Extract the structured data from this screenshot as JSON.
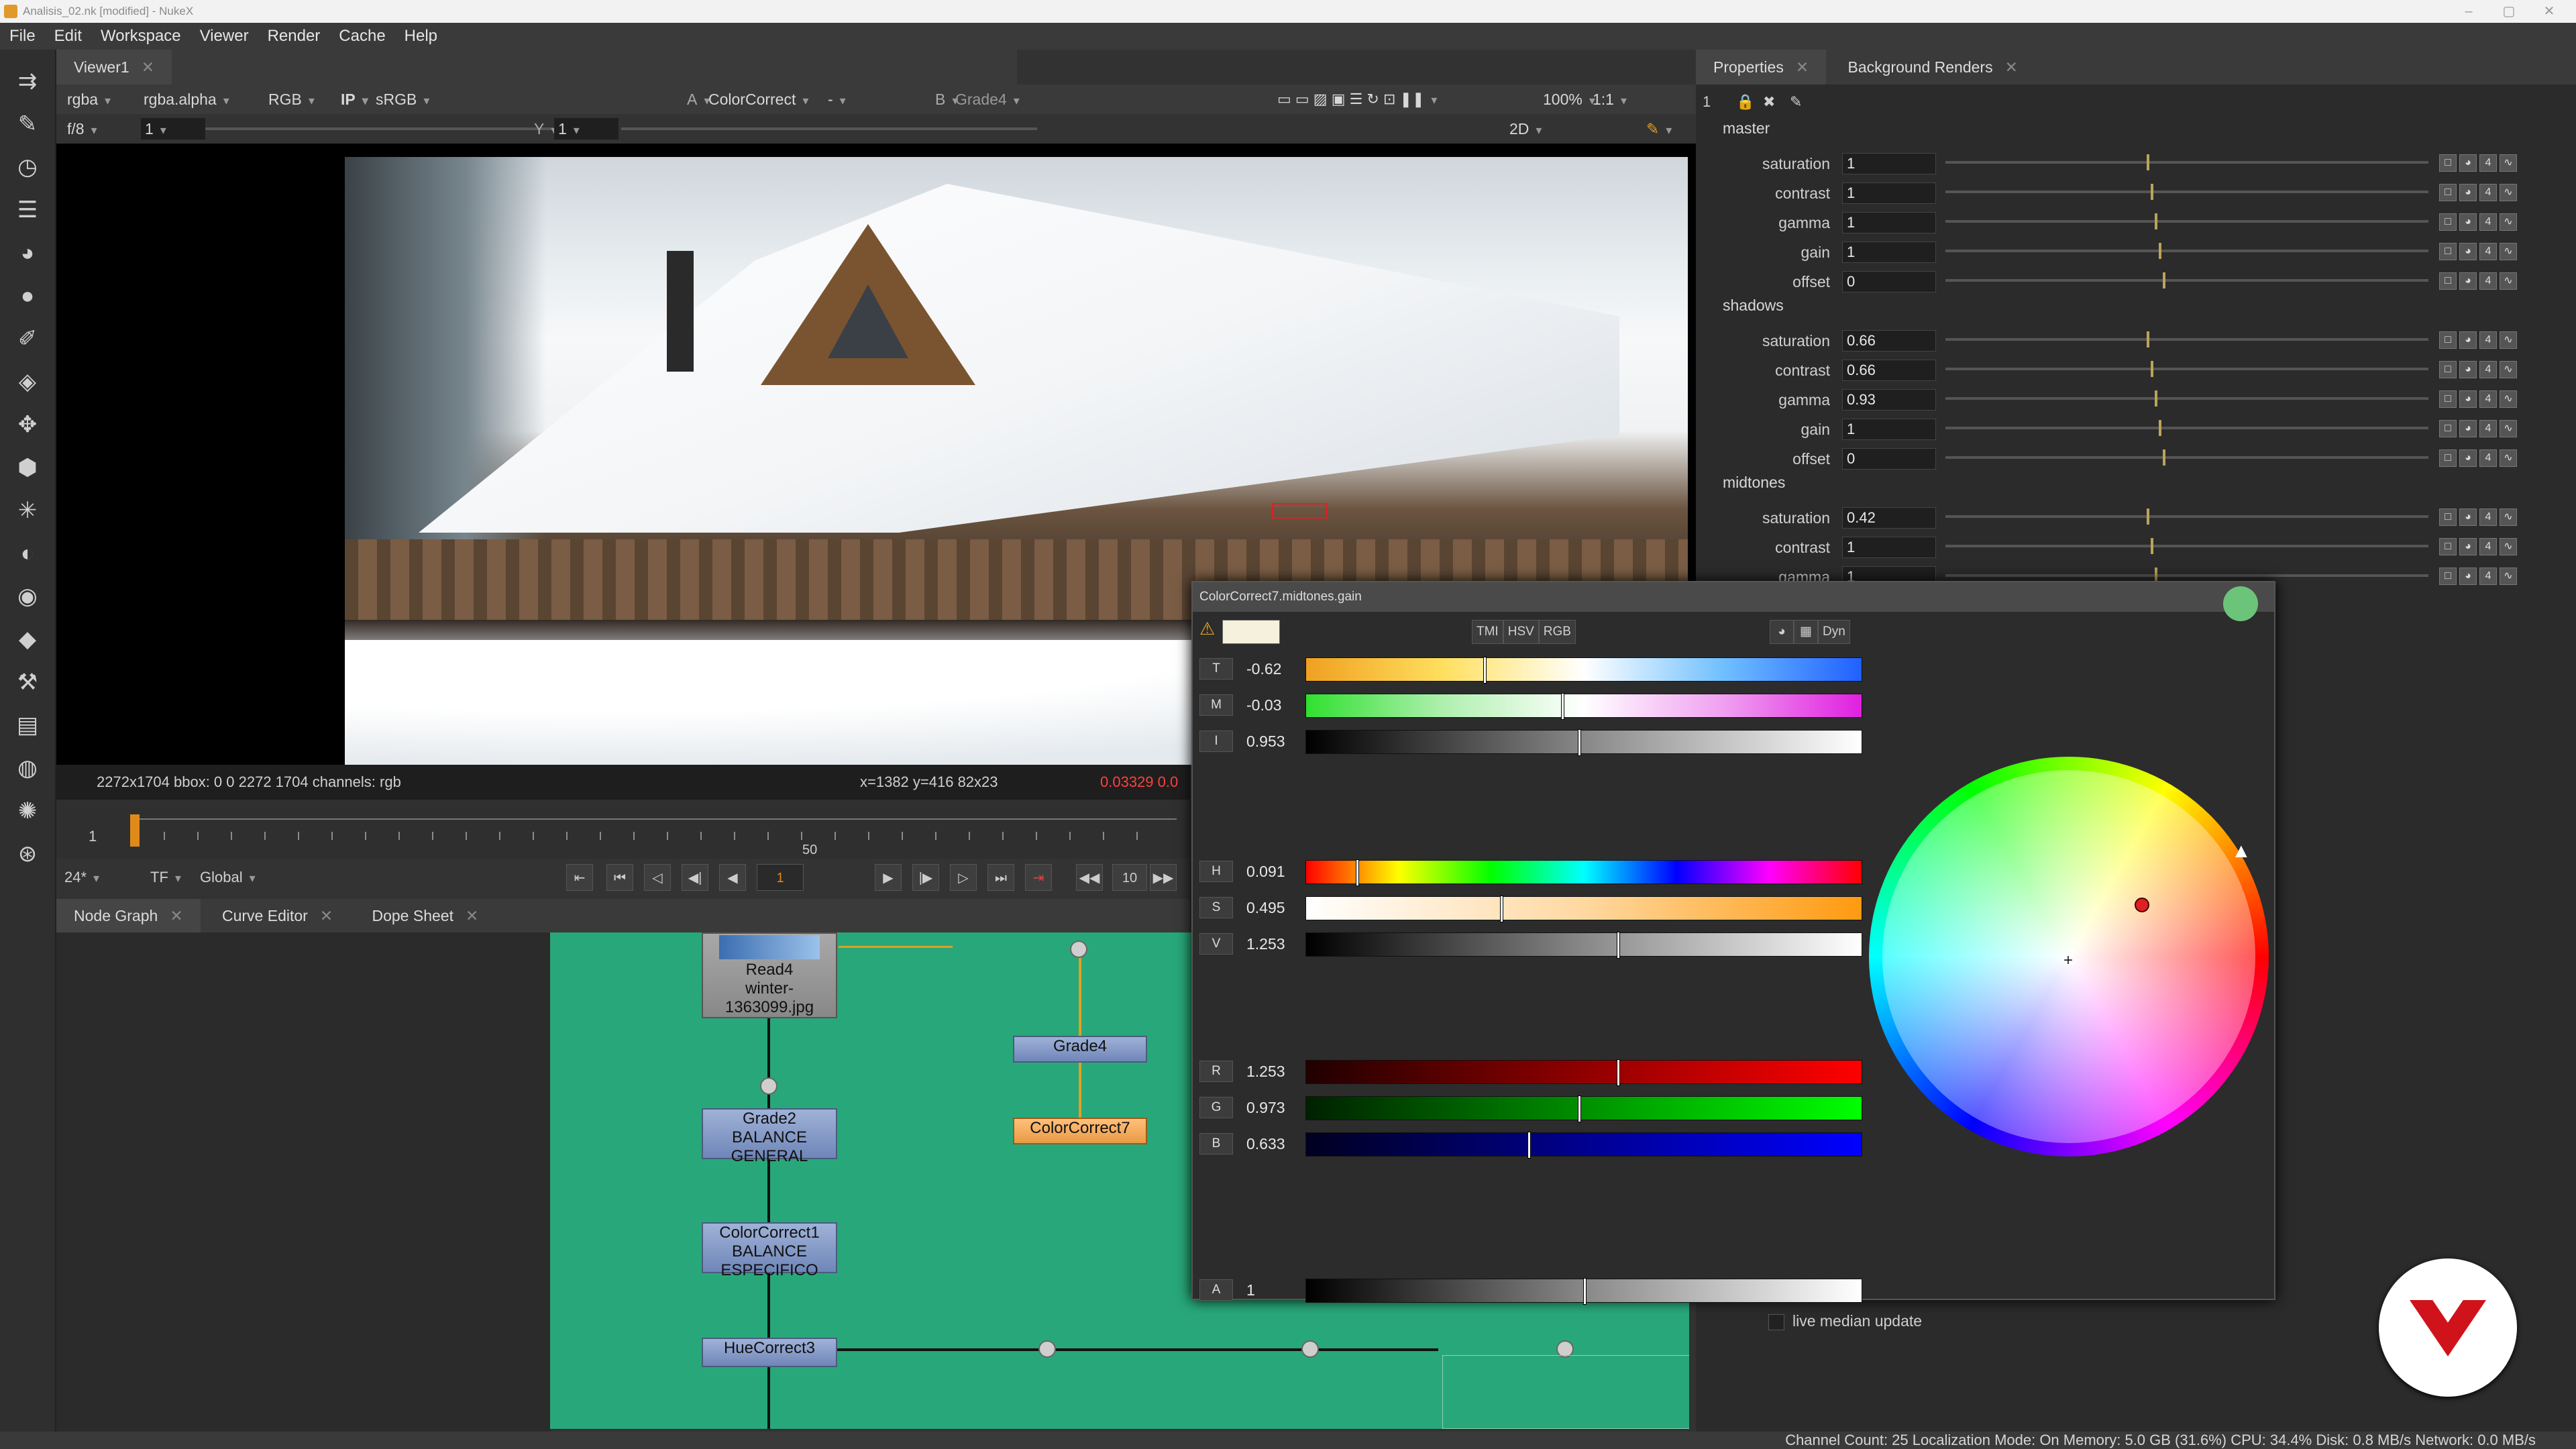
{
  "window": {
    "title": "Analisis_02.nk [modified] - NukeX"
  },
  "menu": [
    "File",
    "Edit",
    "Workspace",
    "Viewer",
    "Render",
    "Cache",
    "Help"
  ],
  "viewer": {
    "tab": "Viewer1",
    "channels": "rgba",
    "alpha": "rgba.alpha",
    "colorspace_display": "RGB",
    "ip": "IP",
    "lut": "sRGB",
    "a_label": "A",
    "a_input": "ColorCorrect",
    "a_op": "-",
    "b_label": "B",
    "b_input": "Grade4",
    "zoom": "100%",
    "ratio": "1:1",
    "fstop": "f/8",
    "frame_field": "1",
    "y_label": "Y",
    "y_field": "1",
    "view_mode": "2D",
    "info": "2272x1704  bbox: 0 0 2272 1704 channels: rgb",
    "pixel_info": "x=1382 y=416 82x23",
    "pixel_values": "0.03329  0.0"
  },
  "timeline": {
    "start": "1",
    "mid": "50",
    "current": "1",
    "fps": "24*",
    "tf": "TF",
    "range": "Global",
    "increment": "10"
  },
  "tabs_bottom": [
    "Node Graph",
    "Curve Editor",
    "Dope Sheet"
  ],
  "nodes": {
    "read": {
      "name": "Read4",
      "file": "winter-1363099.jpg"
    },
    "grade2": {
      "name": "Grade2",
      "label": "BALANCE GENERAL"
    },
    "cc1": {
      "name": "ColorCorrect1",
      "label": "BALANCE ESPECIFICO"
    },
    "hue": {
      "name": "HueCorrect3"
    },
    "grade4": {
      "name": "Grade4"
    },
    "cc7": {
      "name": "ColorCorrect7"
    }
  },
  "properties": {
    "tabs": [
      "Properties",
      "Background Renders"
    ],
    "page": "1",
    "sections": [
      {
        "name": "master",
        "rows": [
          [
            "saturation",
            "1"
          ],
          [
            "contrast",
            "1"
          ],
          [
            "gamma",
            "1"
          ],
          [
            "gain",
            "1"
          ],
          [
            "offset",
            "0"
          ]
        ]
      },
      {
        "name": "shadows",
        "rows": [
          [
            "saturation",
            "0.66"
          ],
          [
            "contrast",
            "0.66"
          ],
          [
            "gamma",
            "0.93"
          ],
          [
            "gain",
            "1"
          ],
          [
            "offset",
            "0"
          ]
        ]
      },
      {
        "name": "midtones",
        "rows": [
          [
            "saturation",
            "0.42"
          ],
          [
            "contrast",
            "1"
          ],
          [
            "gamma",
            "1"
          ]
        ]
      }
    ],
    "live_median": "live median update"
  },
  "color_window": {
    "title": "ColorCorrect7.midtones.gain",
    "modes": [
      "TMI",
      "HSV",
      "RGB"
    ],
    "dyn": "Dyn",
    "rows": [
      {
        "label": "T",
        "value": "-0.62",
        "cursor": 0.32
      },
      {
        "label": "M",
        "value": "-0.03",
        "cursor": 0.46
      },
      {
        "label": "I",
        "value": "0.953",
        "cursor": 0.49
      },
      {
        "label": "H",
        "value": "0.091",
        "cursor": 0.09
      },
      {
        "label": "S",
        "value": "0.495",
        "cursor": 0.35
      },
      {
        "label": "V",
        "value": "1.253",
        "cursor": 0.56
      },
      {
        "label": "R",
        "value": "1.253",
        "cursor": 0.56
      },
      {
        "label": "G",
        "value": "0.973",
        "cursor": 0.49
      },
      {
        "label": "B",
        "value": "0.633",
        "cursor": 0.4
      },
      {
        "label": "A",
        "value": "1",
        "cursor": 0.5
      }
    ]
  },
  "status": "Channel Count: 25  Localization Mode: On  Memory: 5.0 GB (31.6%)  CPU: 34.4%  Disk: 0.8 MB/s  Network: 0.0 MB/s",
  "colors": {
    "node_graph_bg": "#28a87a",
    "accent": "#e09a2a",
    "logo_red": "#d0121b"
  }
}
